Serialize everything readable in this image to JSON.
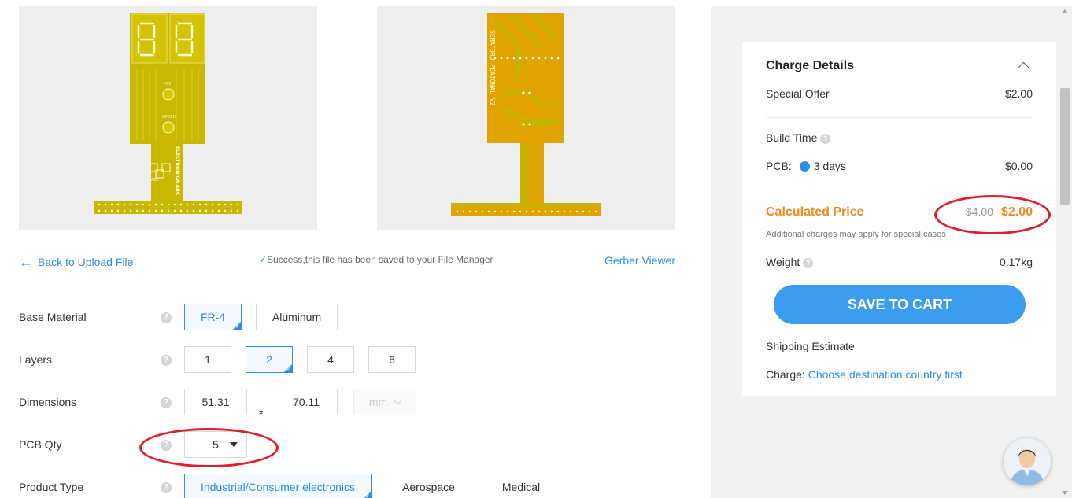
{
  "preview": {
    "board1_silkscreen": [
      "P62",
      "OPECH",
      "ELECTRONICA ABC",
      "ABC"
    ],
    "board2_silkscreen": [
      "SEMAFORO PEATONAL V2"
    ]
  },
  "nav": {
    "back_label": "Back to Upload File",
    "success_text": "Success,this file has been saved to your ",
    "file_manager_link": "File Manager",
    "gerber_viewer": "Gerber Viewer"
  },
  "options": {
    "base_material": {
      "label": "Base Material",
      "choices": [
        "FR-4",
        "Aluminum"
      ],
      "selected": "FR-4"
    },
    "layers": {
      "label": "Layers",
      "choices": [
        "1",
        "2",
        "4",
        "6"
      ],
      "selected": "2"
    },
    "dimensions": {
      "label": "Dimensions",
      "width": "51.31",
      "separator": "*",
      "height": "70.11",
      "unit": "mm"
    },
    "pcb_qty": {
      "label": "PCB Qty",
      "value": "5"
    },
    "product_type": {
      "label": "Product Type",
      "choices": [
        "Industrial/Consumer electronics",
        "Aerospace",
        "Medical"
      ],
      "selected": "Industrial/Consumer electronics"
    },
    "help_symbol": "?"
  },
  "charge": {
    "title": "Charge Details",
    "special_offer_label": "Special Offer",
    "special_offer_value": "$2.00",
    "build_time_label": "Build Time",
    "pcb_label": "PCB:",
    "pcb_option": "3 days",
    "pcb_value": "$0.00",
    "calculated_label": "Calculated Price",
    "old_price": "$4.00",
    "new_price": "$2.00",
    "note_text": "Additional charges may apply for ",
    "note_link": "special cases",
    "weight_label": "Weight",
    "weight_value": "0.17kg",
    "save_button": "SAVE TO CART",
    "shipping_label": "Shipping Estimate",
    "charge_label": "Charge:",
    "charge_link": "Choose destination country first"
  },
  "colors": {
    "accent": "#2b8ee6",
    "price_orange": "#f08a24",
    "annotation_red": "#e01e2b",
    "pcb_gold": "#c8b400",
    "pcb_orange": "#e0a400"
  }
}
